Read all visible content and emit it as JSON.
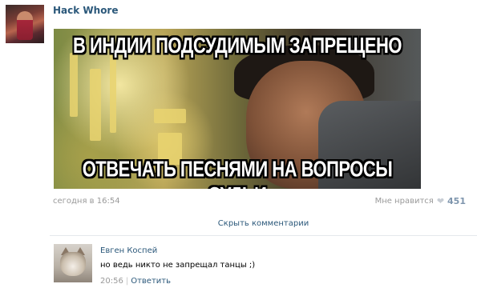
{
  "post": {
    "author": "Hack Whore",
    "meme": {
      "top_text": "В ИНДИИ ПОДСУДИМЫМ ЗАПРЕЩЕНО",
      "bottom_text": "ОТВЕЧАТЬ ПЕСНЯМИ НА ВОПРОСЫ СУДЬИ"
    },
    "date": "сегодня в 16:54",
    "likes_label": "Мне нравится",
    "likes_count": "451",
    "hide_comments_label": "Скрыть комментарии"
  },
  "comment": {
    "author": "Евген Коспей",
    "text": "но ведь никто не запрещал танцы ;)",
    "time": "20:56",
    "separator": "|",
    "reply_label": "Ответить"
  },
  "colors": {
    "link": "#2b587a",
    "muted": "#999999",
    "likes_count": "#7e95ad"
  },
  "icons": [
    "heart-icon"
  ]
}
